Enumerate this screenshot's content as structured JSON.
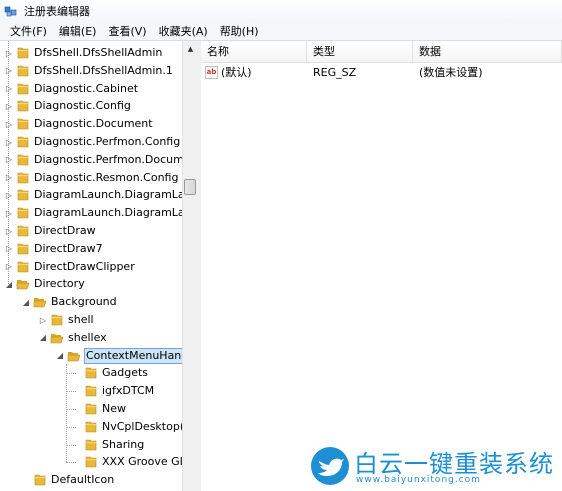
{
  "window": {
    "title": "注册表编辑器"
  },
  "menu": [
    "文件(F)",
    "编辑(E)",
    "查看(V)",
    "收藏夹(A)",
    "帮助(H)"
  ],
  "tree": {
    "items": [
      {
        "label": "DfsShell.DfsShellAdmin",
        "level": 0,
        "expander": "collapsed",
        "open": false
      },
      {
        "label": "DfsShell.DfsShellAdmin.1",
        "level": 0,
        "expander": "collapsed",
        "open": false
      },
      {
        "label": "Diagnostic.Cabinet",
        "level": 0,
        "expander": "collapsed",
        "open": false
      },
      {
        "label": "Diagnostic.Config",
        "level": 0,
        "expander": "collapsed",
        "open": false
      },
      {
        "label": "Diagnostic.Document",
        "level": 0,
        "expander": "collapsed",
        "open": false
      },
      {
        "label": "Diagnostic.Perfmon.Config",
        "level": 0,
        "expander": "collapsed",
        "open": false
      },
      {
        "label": "Diagnostic.Perfmon.Docume",
        "level": 0,
        "expander": "collapsed",
        "open": false
      },
      {
        "label": "Diagnostic.Resmon.Config",
        "level": 0,
        "expander": "collapsed",
        "open": false
      },
      {
        "label": "DiagramLaunch.DiagramLau",
        "level": 0,
        "expander": "collapsed",
        "open": false
      },
      {
        "label": "DiagramLaunch.DiagramLau",
        "level": 0,
        "expander": "collapsed",
        "open": false
      },
      {
        "label": "DirectDraw",
        "level": 0,
        "expander": "collapsed",
        "open": false
      },
      {
        "label": "DirectDraw7",
        "level": 0,
        "expander": "collapsed",
        "open": false
      },
      {
        "label": "DirectDrawClipper",
        "level": 0,
        "expander": "collapsed",
        "open": false
      },
      {
        "label": "Directory",
        "level": 0,
        "expander": "expanded",
        "open": true
      },
      {
        "label": "Background",
        "level": 1,
        "expander": "expanded",
        "open": true
      },
      {
        "label": "shell",
        "level": 2,
        "expander": "collapsed",
        "open": false
      },
      {
        "label": "shellex",
        "level": 2,
        "expander": "expanded",
        "open": true
      },
      {
        "label": "ContextMenuHanc",
        "level": 3,
        "expander": "expanded",
        "open": true,
        "selected": true
      },
      {
        "label": "Gadgets",
        "level": 4,
        "expander": "none",
        "open": false
      },
      {
        "label": "igfxDTCM",
        "level": 4,
        "expander": "none",
        "open": false
      },
      {
        "label": "New",
        "level": 4,
        "expander": "none",
        "open": false
      },
      {
        "label": "NvCplDesktop(",
        "level": 4,
        "expander": "none",
        "open": false
      },
      {
        "label": "Sharing",
        "level": 4,
        "expander": "none",
        "open": false
      },
      {
        "label": "XXX Groove GI",
        "level": 4,
        "expander": "none",
        "open": false
      },
      {
        "label": "DefaultIcon",
        "level": 1,
        "expander": "none",
        "open": false
      }
    ]
  },
  "list": {
    "columns": [
      "名称",
      "类型",
      "数据"
    ],
    "rows": [
      {
        "icon": "string-value-icon",
        "name": "(默认)",
        "type": "REG_SZ",
        "data": "(数值未设置)"
      }
    ]
  },
  "watermark": {
    "brand": "白云一键重装系统",
    "url": "www.baiyunxitong.com",
    "color": "#1e8fd5"
  },
  "colors": {
    "folder": "#e8b83a",
    "selection": "#cce4f7"
  }
}
